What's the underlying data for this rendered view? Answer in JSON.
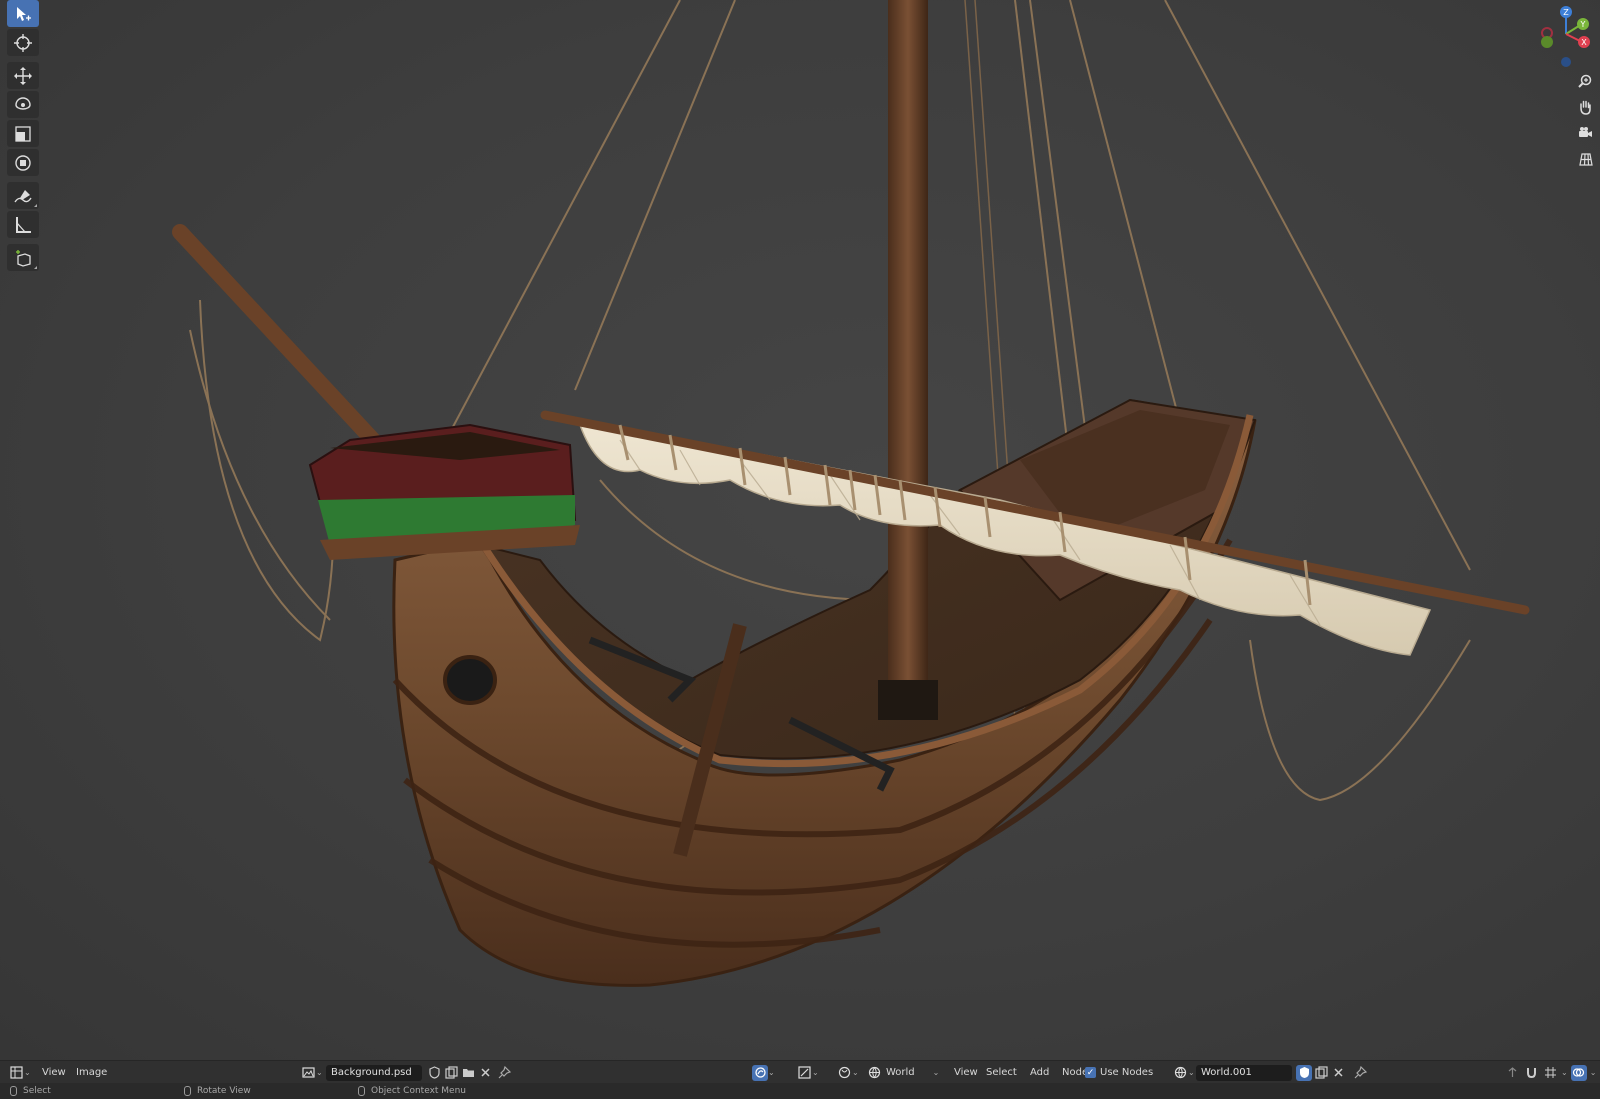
{
  "header": {
    "menus": {
      "view": "View",
      "image": "Image"
    },
    "image_name": "Background.psd",
    "world_label": "World",
    "node_menus": {
      "view": "View",
      "select": "Select",
      "add": "Add",
      "node": "Node"
    },
    "use_nodes_label": "Use Nodes",
    "use_nodes_checked": true,
    "world_datablock": "World.001"
  },
  "status": {
    "left_click": "Select",
    "middle_click": "Rotate View",
    "right_click": "Object Context Menu"
  },
  "toolbar": {
    "tools": [
      "select-box",
      "cursor",
      "move",
      "rotate",
      "scale",
      "transform",
      "annotate",
      "measure",
      "add-cube"
    ],
    "active": "select-box"
  },
  "gizmo": {
    "axes": {
      "z": "Z",
      "y": "Y",
      "x": "X"
    },
    "colors": {
      "x": "#e04050",
      "y": "#7ab63a",
      "z": "#3d7fd8"
    }
  },
  "accent": "#4772b3"
}
